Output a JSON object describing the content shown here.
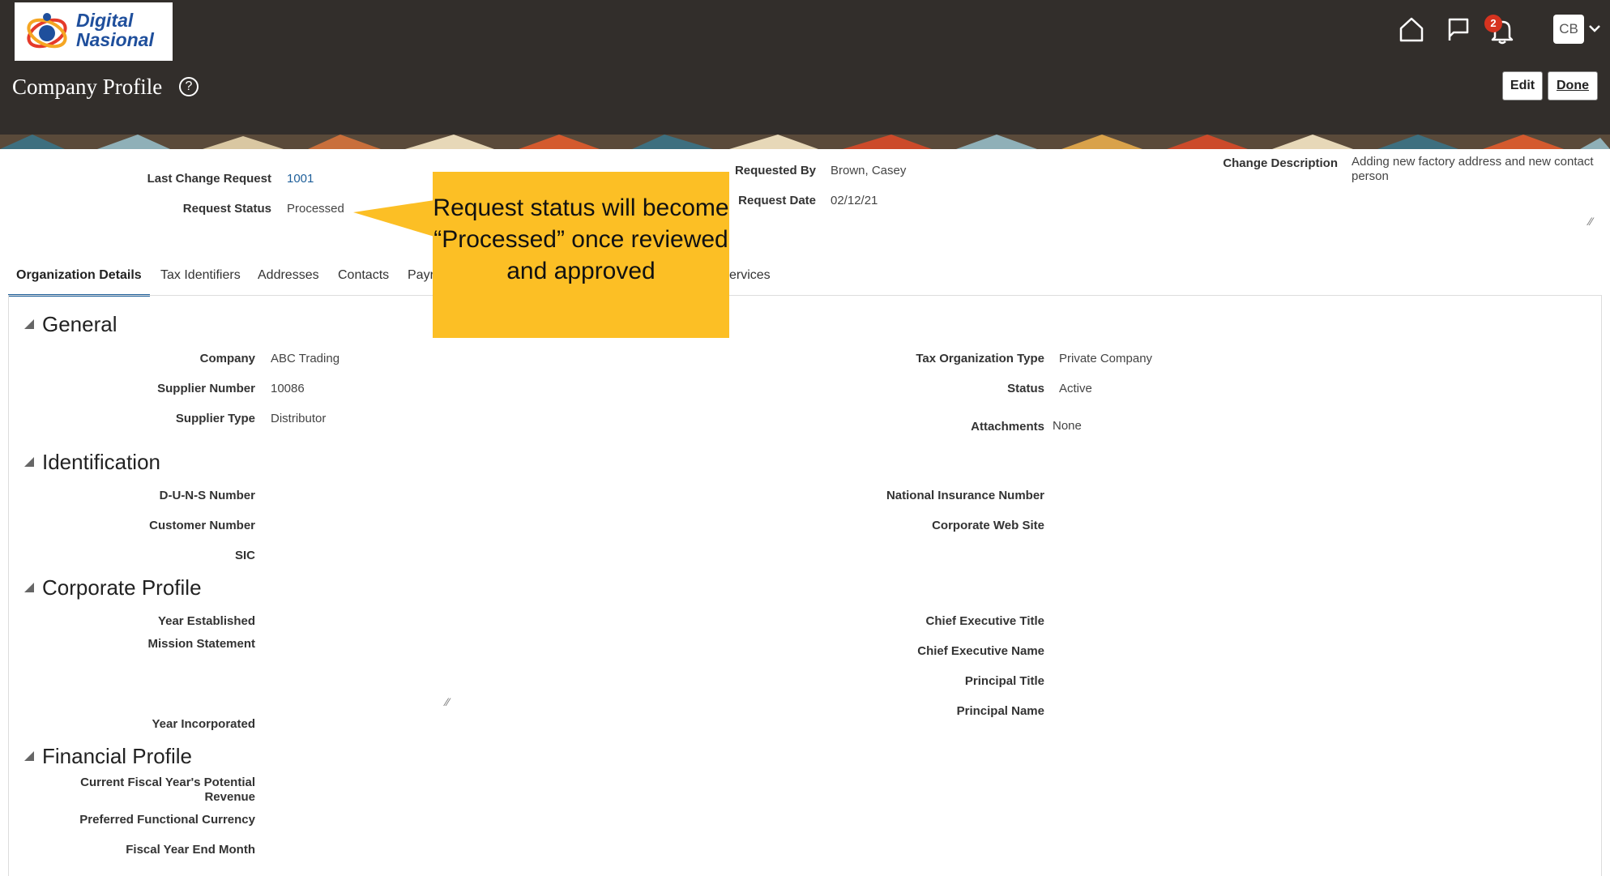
{
  "header": {
    "logo_line1": "Digital",
    "logo_line2": "Nasional",
    "title": "Company Profile",
    "help_icon": "?",
    "notification_count": "2",
    "avatar_initials": "CB",
    "edit_label": "Edit",
    "done_label": "Done"
  },
  "request": {
    "last_change_label": "Last Change Request",
    "last_change_value": "1001",
    "status_label": "Request Status",
    "status_value": "Processed",
    "requested_by_label": "Requested By",
    "requested_by_value": "Brown, Casey",
    "request_date_label": "Request Date",
    "request_date_value": "02/12/21",
    "change_desc_label": "Change Description",
    "change_desc_value": "Adding new factory address and new contact person"
  },
  "tabs": [
    {
      "label": "Organization Details"
    },
    {
      "label": "Tax Identifiers"
    },
    {
      "label": "Addresses"
    },
    {
      "label": "Contacts"
    },
    {
      "label": "Payr"
    },
    {
      "label": "ervices"
    }
  ],
  "callout": {
    "text": "Request status will become “Processed” once reviewed and approved",
    "color": "#fcbf25"
  },
  "general": {
    "title": "General",
    "company_label": "Company",
    "company_value": "ABC Trading",
    "supplier_number_label": "Supplier Number",
    "supplier_number_value": "10086",
    "supplier_type_label": "Supplier Type",
    "supplier_type_value": "Distributor",
    "tax_org_type_label": "Tax Organization Type",
    "tax_org_type_value": "Private Company",
    "status_label": "Status",
    "status_value": "Active",
    "attachments_label": "Attachments",
    "attachments_value": "None"
  },
  "identification": {
    "title": "Identification",
    "duns_label": "D-U-N-S Number",
    "customer_number_label": "Customer Number",
    "sic_label": "SIC",
    "national_insurance_label": "National Insurance Number",
    "corporate_web_site_label": "Corporate Web Site"
  },
  "corporate_profile": {
    "title": "Corporate Profile",
    "year_established_label": "Year Established",
    "mission_statement_label": "Mission Statement",
    "year_incorporated_label": "Year Incorporated",
    "chief_exec_title_label": "Chief Executive Title",
    "chief_exec_name_label": "Chief Executive Name",
    "principal_title_label": "Principal Title",
    "principal_name_label": "Principal Name"
  },
  "financial_profile": {
    "title": "Financial Profile",
    "potential_revenue_label_line1": "Current Fiscal Year's Potential",
    "potential_revenue_label_line2": "Revenue",
    "preferred_currency_label": "Preferred Functional Currency",
    "fiscal_year_end_label": "Fiscal Year End Month"
  },
  "colors": {
    "header_bg": "#322e2b",
    "link": "#1e5f9a",
    "badge": "#d6331f"
  }
}
